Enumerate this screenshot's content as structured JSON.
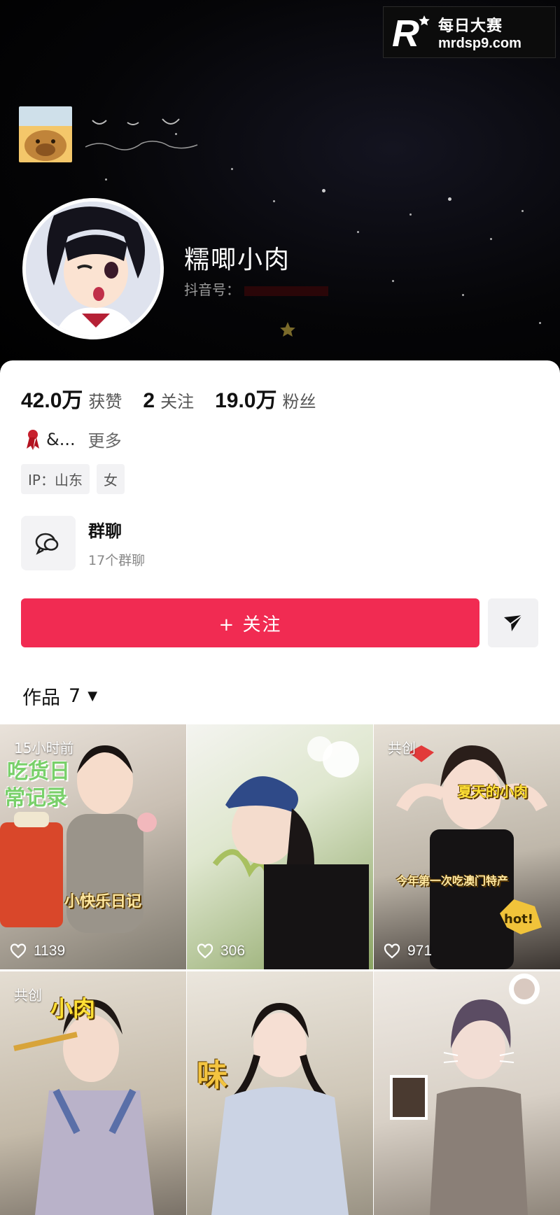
{
  "watermark": {
    "line1": "每日大赛",
    "line2": "mrdsp9.com",
    "logo_letter": "R"
  },
  "profile": {
    "nickname": "糯唧小肉",
    "douyin_id_label": "抖音号："
  },
  "stats": [
    {
      "value": "42.0万",
      "label": "获赞"
    },
    {
      "value": "2",
      "label": "关注"
    },
    {
      "value": "19.0万",
      "label": "粉丝"
    }
  ],
  "bio": {
    "text": "&...",
    "more": "更多",
    "icon": "ribbon-icon"
  },
  "tags": [
    "IP：山东",
    "女"
  ],
  "group_chat": {
    "title": "群聊",
    "subtitle": "17个群聊",
    "icon": "chat-bubbles-icon"
  },
  "actions": {
    "follow_label": "+ 关注",
    "share_icon": "send-arrow-icon"
  },
  "works_tab": {
    "label": "作品",
    "count": "7",
    "caret": "▼"
  },
  "videos": [
    {
      "badge": "15小时前",
      "likes": "1139",
      "caption1": "吃货日",
      "caption2": "常记录",
      "caption3": "小快乐日记"
    },
    {
      "badge": "",
      "likes": "306"
    },
    {
      "badge": "共创",
      "likes": "971",
      "caption1": "夏天的小肉",
      "caption2": "今年第一次吃澳门特产",
      "sticker": "hot!"
    },
    {
      "badge": "共创",
      "likes": "",
      "caption1": "小肉"
    },
    {
      "badge": "",
      "likes": "",
      "caption1": "味"
    },
    {
      "badge": "",
      "likes": ""
    }
  ],
  "colors": {
    "follow": "#f12b52",
    "header_bg": "#000000",
    "card_bg": "#ffffff"
  }
}
